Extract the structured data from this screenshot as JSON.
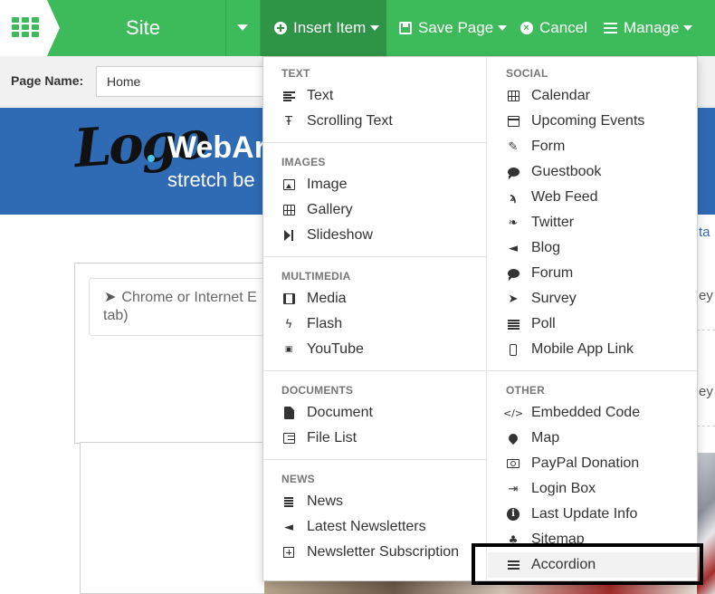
{
  "toolbar": {
    "site_label": "Site",
    "insert_item_label": "Insert Item",
    "save_page_label": "Save Page",
    "cancel_label": "Cancel",
    "manage_label": "Manage"
  },
  "page_name_bar": {
    "label": "Page Name:",
    "value": "Home"
  },
  "website": {
    "logo_text": "Logo",
    "brand_partial": "WebAr",
    "tagline_partial": "stretch be",
    "notice_text": "Chrome or Internet E",
    "notice_text_line2": "tab)",
    "edge_link_text": "ta",
    "edge_text_1": "ey",
    "edge_text_2": "ey"
  },
  "insert_menu": {
    "left_column": [
      {
        "title": "TEXT",
        "items": [
          {
            "label": "Text",
            "icon": "align-left-icon"
          },
          {
            "label": "Scrolling Text",
            "icon": "text-type-icon"
          }
        ]
      },
      {
        "title": "IMAGES",
        "items": [
          {
            "label": "Image",
            "icon": "image-icon"
          },
          {
            "label": "Gallery",
            "icon": "table-grid-icon"
          },
          {
            "label": "Slideshow",
            "icon": "step-forward-icon"
          }
        ]
      },
      {
        "title": "MULTIMEDIA",
        "items": [
          {
            "label": "Media",
            "icon": "film-icon"
          },
          {
            "label": "Flash",
            "icon": "flash-icon"
          },
          {
            "label": "YouTube",
            "icon": "youtube-icon"
          }
        ]
      },
      {
        "title": "DOCUMENTS",
        "items": [
          {
            "label": "Document",
            "icon": "document-icon"
          },
          {
            "label": "File List",
            "icon": "list-box-icon"
          }
        ]
      },
      {
        "title": "NEWS",
        "items": [
          {
            "label": "News",
            "icon": "news-icon"
          },
          {
            "label": "Latest Newsletters",
            "icon": "bullhorn-icon"
          },
          {
            "label": "Newsletter Subscription",
            "icon": "plus-square-icon"
          }
        ]
      }
    ],
    "right_column": [
      {
        "title": "SOCIAL",
        "items": [
          {
            "label": "Calendar",
            "icon": "calendar-grid-icon"
          },
          {
            "label": "Upcoming Events",
            "icon": "calendar-icon"
          },
          {
            "label": "Form",
            "icon": "edit-form-icon"
          },
          {
            "label": "Guestbook",
            "icon": "comment-icon"
          },
          {
            "label": "Web Feed",
            "icon": "rss-icon"
          },
          {
            "label": "Twitter",
            "icon": "twitter-icon"
          },
          {
            "label": "Blog",
            "icon": "bullhorn-icon"
          },
          {
            "label": "Forum",
            "icon": "comment-icon"
          },
          {
            "label": "Survey",
            "icon": "paper-plane-icon"
          },
          {
            "label": "Poll",
            "icon": "poll-list-icon"
          },
          {
            "label": "Mobile App Link",
            "icon": "mobile-phone-icon"
          }
        ]
      },
      {
        "title": "OTHER",
        "items": [
          {
            "label": "Embedded Code",
            "icon": "code-icon"
          },
          {
            "label": "Map",
            "icon": "map-marker-icon"
          },
          {
            "label": "PayPal Donation",
            "icon": "money-icon"
          },
          {
            "label": "Login Box",
            "icon": "sign-in-icon"
          },
          {
            "label": "Last Update Info",
            "icon": "info-circle-icon"
          },
          {
            "label": "Sitemap",
            "icon": "sitemap-icon"
          },
          {
            "label": "Accordion",
            "icon": "menu-lines-icon"
          }
        ]
      }
    ]
  },
  "colors": {
    "toolbar_green": "#3dbb5a",
    "toolbar_active": "#2e9446",
    "banner_blue": "#2f6ab4",
    "highlight_frame": "#000000"
  }
}
